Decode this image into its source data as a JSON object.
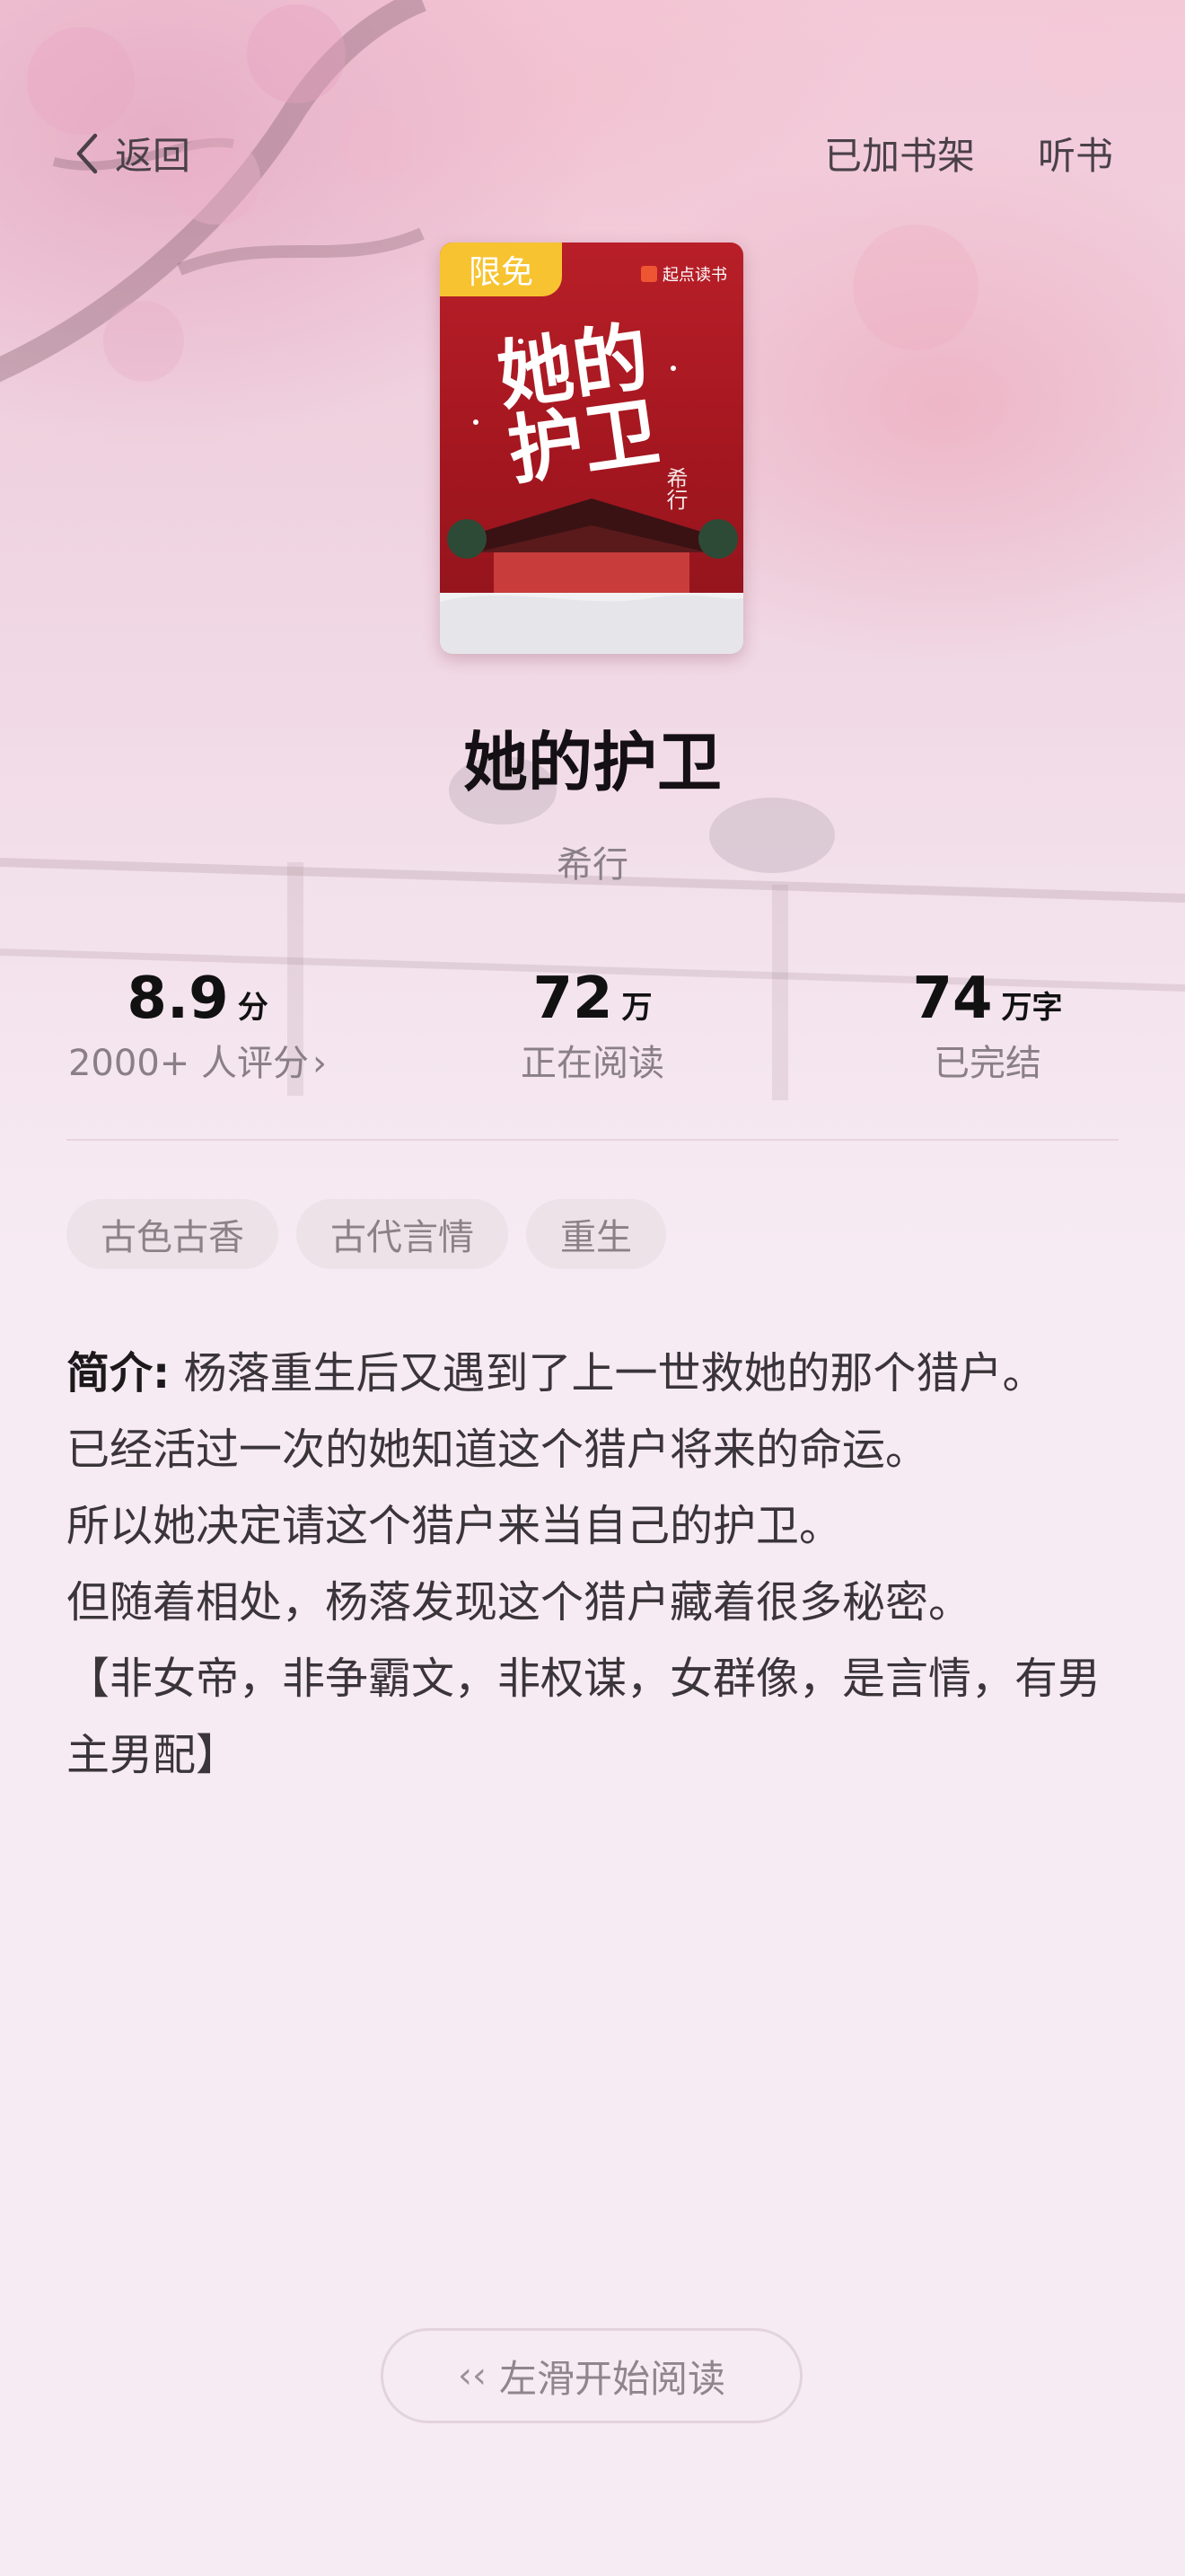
{
  "header": {
    "back_label": "返回",
    "shelf_label": "已加书架",
    "listen_label": "听书"
  },
  "cover": {
    "badge": "限免",
    "publisher": "起点读书",
    "title_art": "她的护卫",
    "author_art": "希行"
  },
  "book": {
    "title": "她的护卫",
    "author": "希行"
  },
  "stats": {
    "rating": {
      "value": "8.9",
      "unit": "分",
      "label": "2000+ 人评分"
    },
    "readers": {
      "value": "72",
      "unit": "万",
      "label": "正在阅读"
    },
    "words": {
      "value": "74",
      "unit": "万字",
      "label": "已完结"
    }
  },
  "tags": [
    "古色古香",
    "古代言情",
    "重生"
  ],
  "intro": {
    "lead": "简介:",
    "first": " 杨落重生后又遇到了上一世救她的那个猎户。",
    "lines": [
      "已经活过一次的她知道这个猎户将来的命运。",
      "所以她决定请这个猎户来当自己的护卫。",
      "但随着相处，杨落发现这个猎户藏着很多秘密。",
      "【非女帝，非争霸文，非权谋，女群像，是言情，有男主男配】"
    ]
  },
  "footer": {
    "swipe_label": "左滑开始阅读"
  },
  "colors": {
    "badge": "#f7c331",
    "cover_red": "#b81f28",
    "tag_bg": "#ece2e8",
    "page_bg": "#f7ebf3"
  }
}
